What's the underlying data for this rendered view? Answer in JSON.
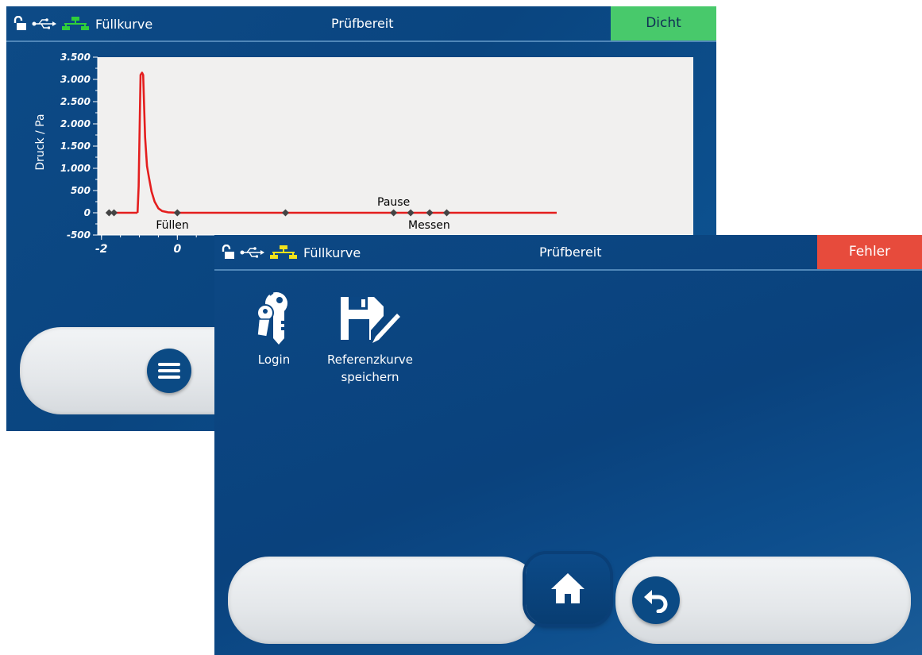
{
  "screen1": {
    "topbar": {
      "mode": "Füllkurve",
      "title": "Prüfbereit",
      "status": "Dicht",
      "status_color": "#48c96b"
    },
    "icons": [
      "lock-open-icon",
      "usb-icon",
      "network-icon-green"
    ],
    "menu_button_icon": "hamburger-menu-icon"
  },
  "screen2": {
    "topbar": {
      "mode": "Füllkurve",
      "title": "Prüfbereit",
      "status": "Fehler",
      "status_color": "#e74b3c"
    },
    "icons": [
      "lock-open-icon",
      "usb-icon",
      "network-icon-yellow"
    ],
    "menu": [
      {
        "label": "Login",
        "icon": "keys-icon"
      },
      {
        "label_line1": "Referenzkurve",
        "label_line2": "speichern",
        "icon": "save-curve-icon"
      }
    ],
    "nav": {
      "home_icon": "home-icon",
      "back_icon": "undo-icon"
    }
  },
  "chart_data": {
    "type": "line",
    "ylabel": "Druck / Pa",
    "y_ticks": [
      "3.500",
      "3.000",
      "2.500",
      "2.000",
      "1.500",
      "1.000",
      "500",
      "0",
      "-500"
    ],
    "ylim": [
      -500,
      3500
    ],
    "x_ticks": [
      "-2",
      "0"
    ],
    "series": [
      {
        "color": "#e41e1e",
        "points": [
          [
            -1.05,
            0
          ],
          [
            -1.02,
            600
          ],
          [
            -0.98,
            2600
          ],
          [
            -0.97,
            3100
          ],
          [
            -0.93,
            3150
          ],
          [
            -0.9,
            3100
          ],
          [
            -0.88,
            2500
          ],
          [
            -0.85,
            1700
          ],
          [
            -0.8,
            1050
          ],
          [
            -0.75,
            800
          ],
          [
            -0.68,
            480
          ],
          [
            -0.6,
            250
          ],
          [
            -0.5,
            100
          ],
          [
            -0.4,
            40
          ],
          [
            -0.25,
            10
          ],
          [
            0,
            0
          ],
          [
            3,
            0
          ],
          [
            6,
            0
          ],
          [
            10,
            0
          ]
        ]
      }
    ],
    "markers_x": [
      -1.8,
      -1.67,
      0.0,
      2.85,
      5.7,
      6.15,
      6.65,
      7.1
    ],
    "phase_labels": [
      {
        "text": "Füllen",
        "x": 0.0
      },
      {
        "text": "Pause",
        "x": 5.7
      },
      {
        "text": "Messen",
        "x": 6.65
      }
    ]
  }
}
